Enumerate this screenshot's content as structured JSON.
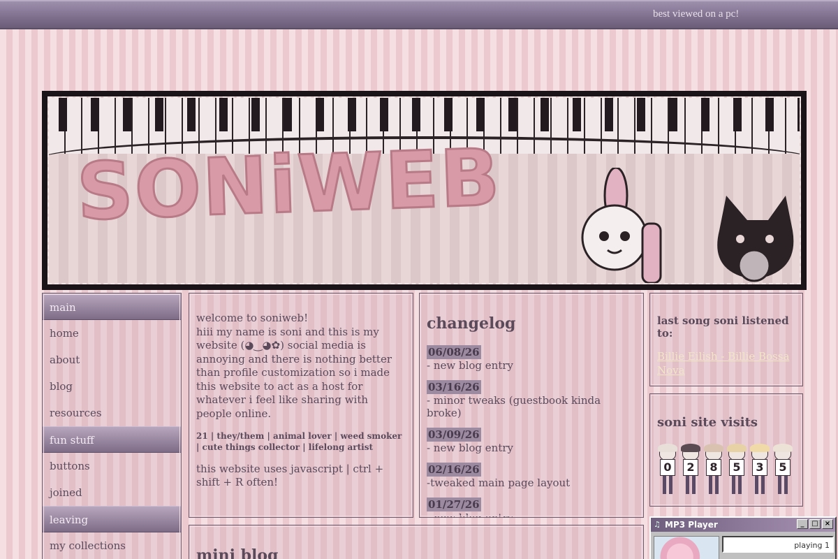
{
  "topbar": {
    "tagline": "best viewed on a pc!"
  },
  "banner": {
    "logo_text": "SONiWEB"
  },
  "nav": {
    "sections": [
      {
        "heading": "main",
        "items": [
          "home",
          "about",
          "blog",
          "resources"
        ]
      },
      {
        "heading": "fun stuff",
        "items": [
          "buttons",
          "joined"
        ]
      },
      {
        "heading": "leaving",
        "items": [
          "my collections"
        ]
      }
    ]
  },
  "welcome": {
    "line1": "welcome to soniweb!",
    "body": "hiii my name is soni and this is my website (◕‿◕✿) social media is annoying and there is nothing better than profile customization so i made this website to act as a host for whatever i feel like sharing with people online.",
    "bio": "21 | they/them | animal lover | weed smoker | cute things collector | lifelong artist",
    "js_note": "this website uses javascript | ctrl + shift + R often!"
  },
  "changelog": {
    "title": "changelog",
    "entries": [
      {
        "date": "06/08/26",
        "text": "- new blog entry"
      },
      {
        "date": "03/16/26",
        "text": "- minor tweaks (guestbook kinda broke)"
      },
      {
        "date": "03/09/26",
        "text": "- new blog entry"
      },
      {
        "date": "02/16/26",
        "text": "-tweaked main page layout"
      },
      {
        "date": "01/27/26",
        "text": "- new blog entry"
      }
    ]
  },
  "last_song": {
    "heading": "last song soni listened to:",
    "song": "Billie Eilish - Billie Bossa Nova"
  },
  "visits": {
    "heading": "soni site visits",
    "digits": [
      "0",
      "2",
      "8",
      "5",
      "3",
      "5"
    ],
    "hair_colors": [
      "#e8e0d8",
      "#5a4a52",
      "#d9c3b0",
      "#e7d2a6",
      "#f0dba8",
      "#ece3d6"
    ]
  },
  "mini_blog": {
    "title": "mini blog"
  },
  "mp3": {
    "title": "MP3 Player",
    "screen_text": "playing 1",
    "buttons": [
      "minimize",
      "maximize",
      "close"
    ]
  }
}
